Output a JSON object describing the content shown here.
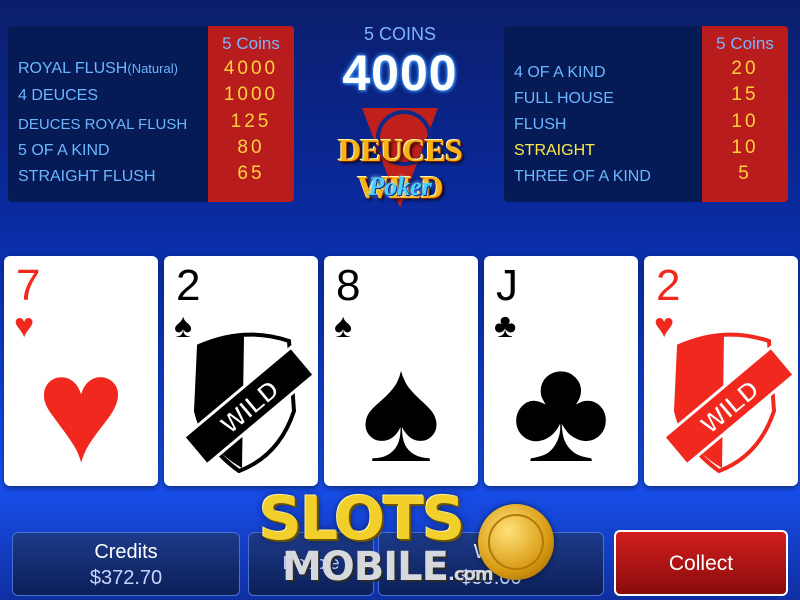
{
  "header": {
    "coins_label": "5 COINS",
    "top_payout": "4000",
    "logo_main": "DEUCES WILD",
    "logo_sub": "Poker"
  },
  "paytable_left": {
    "column_header": "5 Coins",
    "rows": [
      {
        "hand": "ROYAL FLUSH",
        "note": "(Natural)",
        "payout": "4000"
      },
      {
        "hand": "4 DEUCES",
        "payout": "1000"
      },
      {
        "hand": "DEUCES ROYAL FLUSH",
        "payout": "125"
      },
      {
        "hand": "5 OF A KIND",
        "payout": "80"
      },
      {
        "hand": "STRAIGHT FLUSH",
        "payout": "65"
      }
    ]
  },
  "paytable_right": {
    "column_header": "5 Coins",
    "rows": [
      {
        "hand": "4 OF A KIND",
        "payout": "20"
      },
      {
        "hand": "FULL HOUSE",
        "payout": "15"
      },
      {
        "hand": "FLUSH",
        "payout": "10"
      },
      {
        "hand": "STRAIGHT",
        "payout": "10",
        "highlight": true
      },
      {
        "hand": "THREE OF A KIND",
        "payout": "5"
      }
    ]
  },
  "cards": [
    {
      "rank": "7",
      "suit": "♥",
      "color": "#f0281e"
    },
    {
      "rank": "2",
      "suit": "♠",
      "color": "#000000",
      "wild_text": "WILD"
    },
    {
      "rank": "8",
      "suit": "♠",
      "color": "#000000"
    },
    {
      "rank": "J",
      "suit": "♣",
      "color": "#000000"
    },
    {
      "rank": "2",
      "suit": "♥",
      "color": "#f0281e",
      "wild_text": "WILD"
    }
  ],
  "bottom": {
    "credits_label": "Credits",
    "credits_value": "$372.70",
    "double_label": "Double",
    "win_label": "Win",
    "win_value": "$50.00",
    "collect_label": "Collect"
  },
  "watermark": {
    "line1": "SLOTS",
    "line2": "MOBILE",
    "suffix": ".com"
  },
  "colors": {
    "paytable_bg": "#061a55",
    "paytable_column": "#b81c1c",
    "highlight": "#ffe94a",
    "collect_button": "#d21e1e"
  }
}
